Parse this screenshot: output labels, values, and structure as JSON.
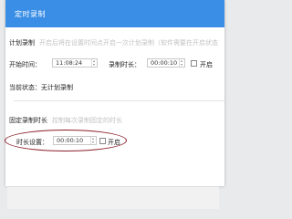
{
  "dialog": {
    "title": "定时录制"
  },
  "scheduled": {
    "section_label": "计划录制",
    "section_hint": "开启后将在设置时间点开启一次计划录制（软件需要在开启状态",
    "start_time_label": "开始时间：",
    "start_time_value": "11:08:24",
    "duration_label": "录制时长：",
    "duration_value": "00:00:10",
    "enable_label": "开启",
    "status_text": "当前状态：无计划录制"
  },
  "fixed": {
    "section_label": "固定录制时长",
    "section_hint": "控制每次录制固定的时长",
    "duration_label": "时长设置：",
    "duration_value": "00:00:10",
    "enable_label": "开启"
  },
  "colors": {
    "titlebar": "#3a8ee6",
    "highlight_ellipse": "#8a1f2a"
  }
}
